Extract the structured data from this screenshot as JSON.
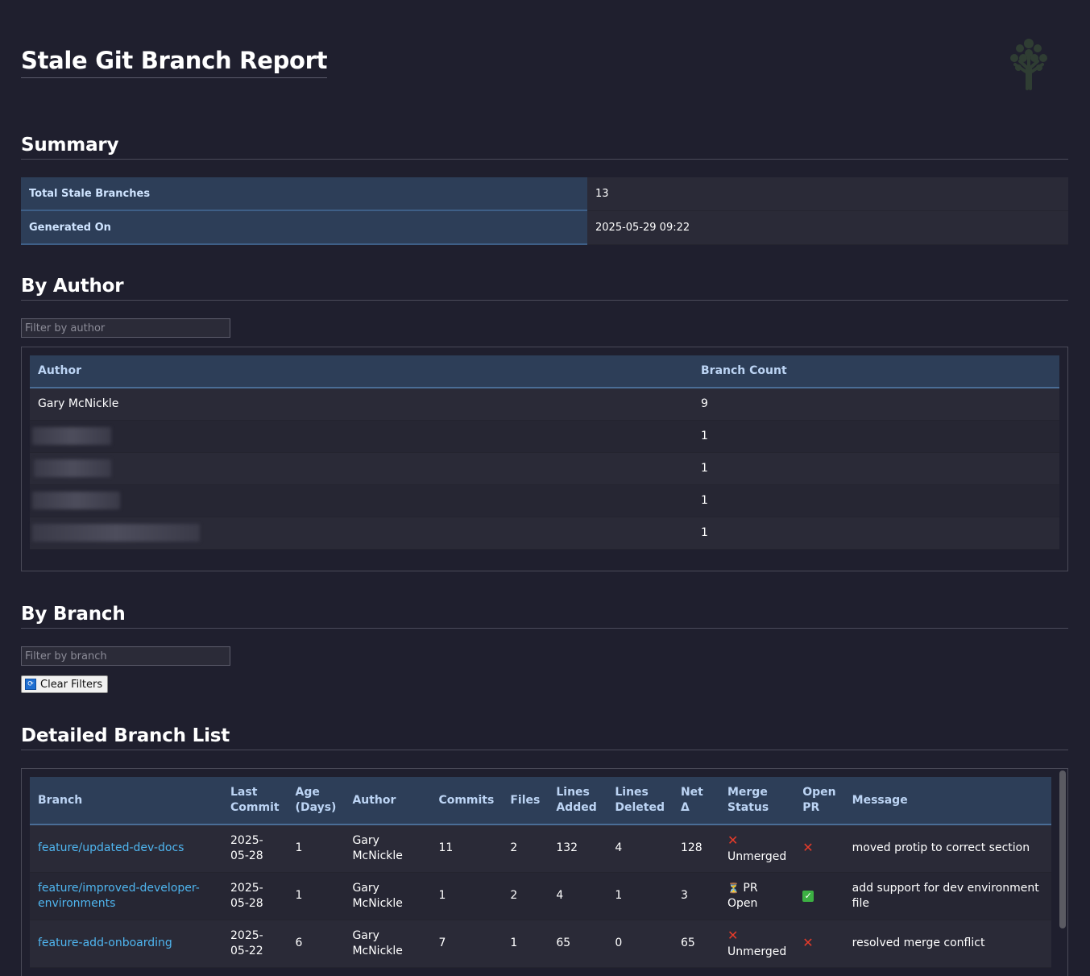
{
  "title": "Stale Git Branch Report",
  "summary": {
    "heading": "Summary",
    "rows": [
      {
        "label": "Total Stale Branches",
        "value": "13"
      },
      {
        "label": "Generated On",
        "value": "2025-05-29 09:22"
      }
    ]
  },
  "by_author": {
    "heading": "By Author",
    "filter_placeholder": "Filter by author",
    "columns": [
      "Author",
      "Branch Count"
    ],
    "rows": [
      {
        "author": "Gary McNickle",
        "count": "9"
      },
      {
        "author": "",
        "count": "1"
      },
      {
        "author": "",
        "count": "1"
      },
      {
        "author": "",
        "count": "1"
      },
      {
        "author": "",
        "count": "1"
      }
    ]
  },
  "by_branch": {
    "heading": "By Branch",
    "filter_placeholder": "Filter by branch",
    "clear_label": "Clear Filters"
  },
  "detailed": {
    "heading": "Detailed Branch List",
    "columns": [
      "Branch",
      "Last Commit",
      "Age (Days)",
      "Author",
      "Commits",
      "Files",
      "Lines Added",
      "Lines Deleted",
      "Net Δ",
      "Merge Status",
      "Open PR",
      "Message"
    ],
    "rows": [
      {
        "branch": "feature/updated-dev-docs",
        "last_commit": "2025-05-28",
        "age": "1",
        "author": "Gary McNickle",
        "commits": "11",
        "files": "2",
        "added": "132",
        "deleted": "4",
        "net": "128",
        "merge_icon": "cross-icon",
        "merge_status": "Unmerged",
        "open_pr_icon": "cross-icon",
        "message": "moved protip to correct section"
      },
      {
        "branch": "feature/improved-developer-environments",
        "last_commit": "2025-05-28",
        "age": "1",
        "author": "Gary McNickle",
        "commits": "1",
        "files": "2",
        "added": "4",
        "deleted": "1",
        "net": "3",
        "merge_icon": "hourglass-icon",
        "merge_status": "PR Open",
        "open_pr_icon": "check-icon",
        "message": "add support for dev environment file"
      },
      {
        "branch": "feature-add-onboarding",
        "last_commit": "2025-05-22",
        "age": "6",
        "author": "Gary McNickle",
        "commits": "7",
        "files": "1",
        "added": "65",
        "deleted": "0",
        "net": "65",
        "merge_icon": "cross-icon",
        "merge_status": "Unmerged",
        "open_pr_icon": "cross-icon",
        "message": "resolved merge conflict"
      }
    ]
  },
  "colors": {
    "background": "#1f1f2e",
    "header_bg": "#2d3e58",
    "link": "#4fb6f0",
    "error": "#e53b2a",
    "success": "#3cb043"
  },
  "icons": [
    "tree-logo-icon",
    "refresh-icon",
    "cross-icon",
    "hourglass-icon",
    "check-icon"
  ]
}
